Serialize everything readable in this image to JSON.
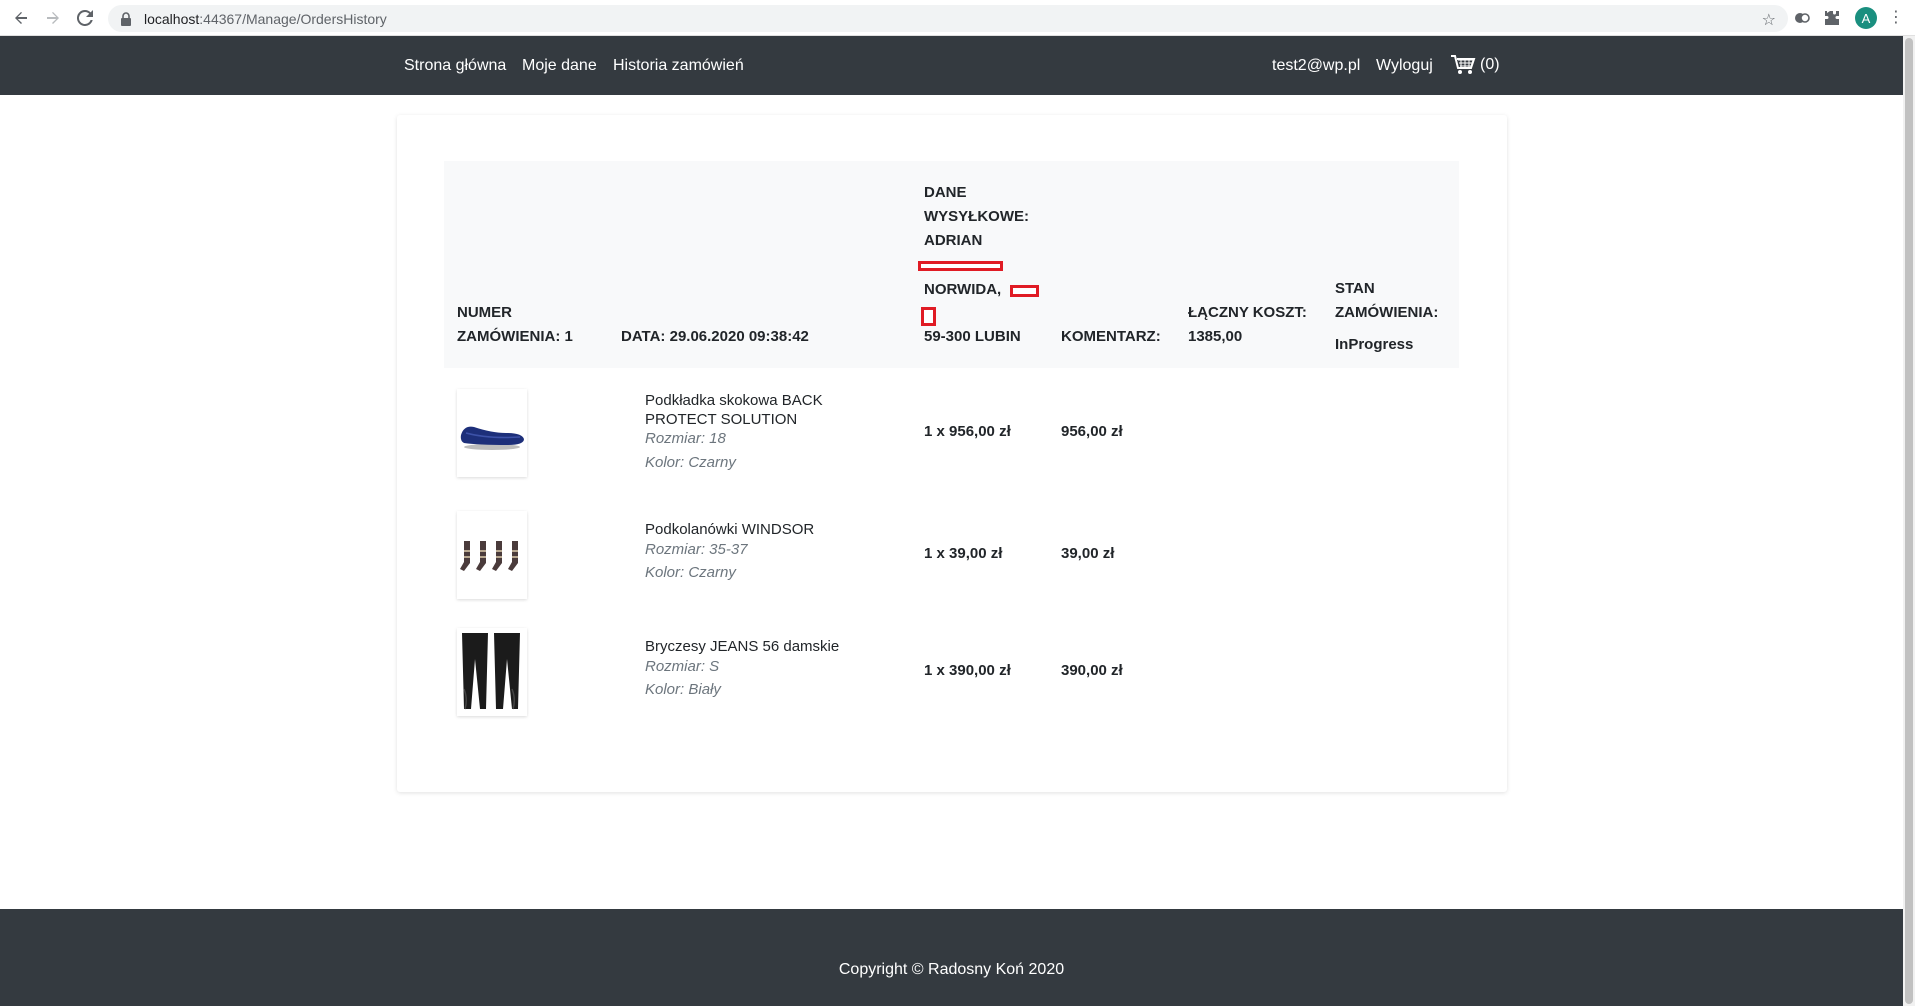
{
  "browser": {
    "url_host": "localhost",
    "url_path": ":44367/Manage/OrdersHistory",
    "avatar_letter": "A"
  },
  "navbar": {
    "links": [
      "Strona główna",
      "Moje dane",
      "Historia zamówień"
    ],
    "user_email": "test2@wp.pl",
    "logout": "Wyloguj",
    "cart_count": "(0)"
  },
  "order": {
    "header": {
      "number_label_1": "NUMER",
      "number_label_2": "ZAMÓWIENIA: 1",
      "date": "DATA: 29.06.2020 09:38:42",
      "shipping_1": "DANE",
      "shipping_2": "WYSYŁKOWE:",
      "shipping_3": "ADRIAN",
      "shipping_4": "NORWIDA,",
      "shipping_5": "59-300 LUBIN",
      "comment": "KOMENTARZ:",
      "total_label": "ŁĄCZNY KOSZT:",
      "total_value": "1385,00",
      "status_1": "STAN",
      "status_2": "ZAMÓWIENIA:",
      "status_value": "InProgress"
    },
    "items": [
      {
        "name": "Podkładka skokowa BACK PROTECT SOLUTION",
        "size": "Rozmiar: 18",
        "color": "Kolor: Czarny",
        "qty_price": "1 x 956,00 zł",
        "total": "956,00 zł"
      },
      {
        "name": "Podkolanówki WINDSOR",
        "size": "Rozmiar: 35-37",
        "color": "Kolor: Czarny",
        "qty_price": "1 x 39,00 zł",
        "total": "39,00 zł"
      },
      {
        "name": "Bryczesy JEANS 56 damskie",
        "size": "Rozmiar: S",
        "color": "Kolor: Biały",
        "qty_price": "1 x 390,00 zł",
        "total": "390,00 zł"
      }
    ]
  },
  "footer": {
    "copyright": "Copyright © Radosny Koń 2020"
  },
  "colors": {
    "navbar_bg": "#343a40",
    "redaction": "#e01b24"
  }
}
